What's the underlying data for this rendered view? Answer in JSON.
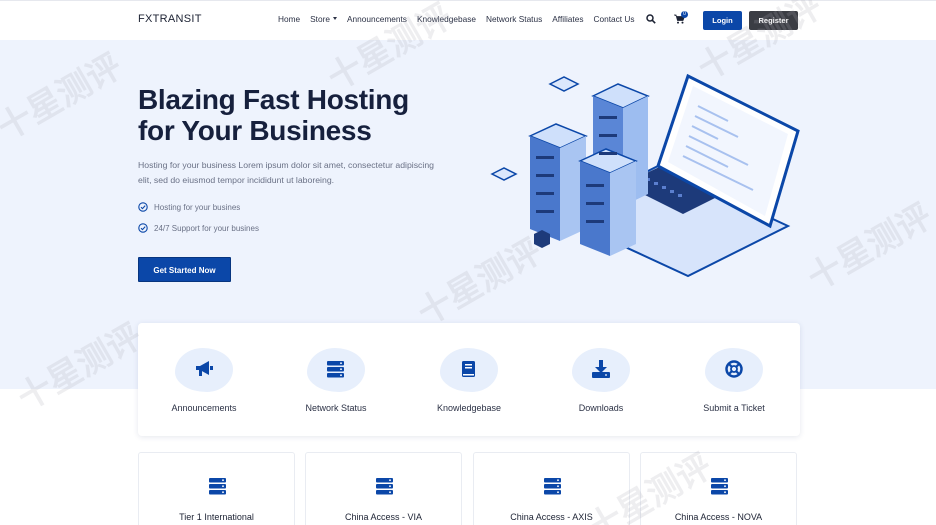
{
  "header": {
    "logo": "FXTRANSIT",
    "nav": [
      "Home",
      "Store",
      "Announcements",
      "Knowledgebase",
      "Network Status",
      "Affiliates",
      "Contact Us"
    ],
    "cart_count": "0",
    "login": "Login",
    "register": "Register"
  },
  "hero": {
    "title_line1": "Blazing Fast Hosting",
    "title_line2": "for Your Business",
    "desc": "Hosting for your business Lorem ipsum dolor sit amet, consectetur adipiscing elit, sed do eiusmod tempor incididunt ut laboreing.",
    "features": [
      "Hosting for your busines",
      "24/7 Support for your busines"
    ],
    "cta": "Get Started Now"
  },
  "quick_links": [
    {
      "label": "Announcements",
      "icon": "megaphone-icon"
    },
    {
      "label": "Network Status",
      "icon": "server-icon"
    },
    {
      "label": "Knowledgebase",
      "icon": "book-icon"
    },
    {
      "label": "Downloads",
      "icon": "download-icon"
    },
    {
      "label": "Submit a Ticket",
      "icon": "lifebuoy-icon"
    }
  ],
  "services": [
    {
      "label": "Tier 1 International",
      "icon": "server-icon"
    },
    {
      "label": "China Access - VIA",
      "icon": "server-icon"
    },
    {
      "label": "China Access - AXIS",
      "icon": "server-icon"
    },
    {
      "label": "China Access - NOVA",
      "icon": "server-icon"
    }
  ],
  "watermark": "十星测评",
  "colors": {
    "primary": "#0b47a8",
    "hero_bg": "#eef3fd",
    "dark_button": "#3b3d44"
  }
}
